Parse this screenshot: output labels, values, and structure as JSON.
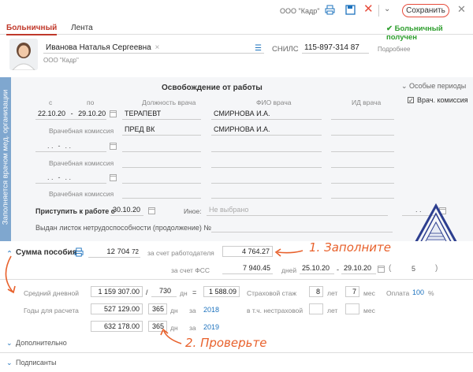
{
  "header": {
    "company": "ООО \"Кадр\"",
    "save_label": "Сохранить",
    "status": "Больничный получен"
  },
  "tabs": [
    {
      "label": "Больничный"
    },
    {
      "label": "Лента"
    }
  ],
  "person": {
    "name": "Иванова Наталья Сергеевна",
    "org": "ООО \"Кадр\"",
    "snils_label": "СНИЛС",
    "snils": "115-897-314 87",
    "details": "Подробнее"
  },
  "release": {
    "side_label": "Заполняется врачом мед. организации",
    "title": "Освобождение от работы",
    "special_periods": "Особые периоды",
    "vk_label": "Врач. комиссия",
    "col_from": "с",
    "col_to": "по",
    "col_position": "Должность врача",
    "col_name": "ФИО врача",
    "col_id": "ИД врача",
    "row1": {
      "from": "22.10.20",
      "sep": "-",
      "to": "29.10.20",
      "position": "ТЕРАПЕВТ",
      "doctor": "СМИРНОВА И.А."
    },
    "vk1_label": "Врачебная комиссия",
    "vk1": {
      "position": "ПРЕД ВК",
      "doctor": "СМИРНОВА И.А."
    },
    "date_placeholder": ". .",
    "vk2_label": "Врачебная комиссия",
    "vk3_label": "Врачебная комиссия",
    "start_label": "Приступить к работе с",
    "start_date": "30.10.20",
    "other_label": "Иное:",
    "other_value": "Не выбрано",
    "continuation_label": "Выдан листок нетрудоспособности (продолжение) №"
  },
  "benefit": {
    "title": "Сумма пособия",
    "total": "12 704",
    "total_suffix": "72",
    "employer_label": "за счет работодателя",
    "employer_value": "4 764.27",
    "fss_label": "за счет ФСС",
    "fss_value": "7 940.45",
    "days_label": "дней",
    "fss_from": "25.10.20",
    "fss_to": "29.10.20",
    "fss_days": "5",
    "avg_label": "Средний дневной",
    "avg_income": "1 159 307.00",
    "avg_div": "/",
    "avg_days": "730",
    "days_unit": "дн",
    "equals": "=",
    "avg_value": "1 588.09",
    "years_label": "Годы для расчета",
    "year1_sum": "527 129.00",
    "year1_days": "365",
    "for_label": "за",
    "year1": "2018",
    "year2_sum": "632 178.00",
    "year2_days": "365",
    "year2": "2019",
    "insurance_label": "Страховой стаж",
    "ins_years": "8",
    "years_unit": "лет",
    "ins_months": "7",
    "months_unit": "мес",
    "payment_label": "Оплата",
    "payment_value": "100",
    "percent": "%",
    "noninsurance_label": "в т.ч. нестраховой",
    "additional": "Дополнительно",
    "signers": "Подписанты"
  },
  "notes": {
    "fill": "1. Заполните",
    "check": "2. Проверьте"
  },
  "colors": {
    "accent": "#e74c3c",
    "blue": "#1e73be",
    "note": "#e8612c",
    "strip": "#7fa7cf",
    "ok": "#2e9e2e"
  }
}
